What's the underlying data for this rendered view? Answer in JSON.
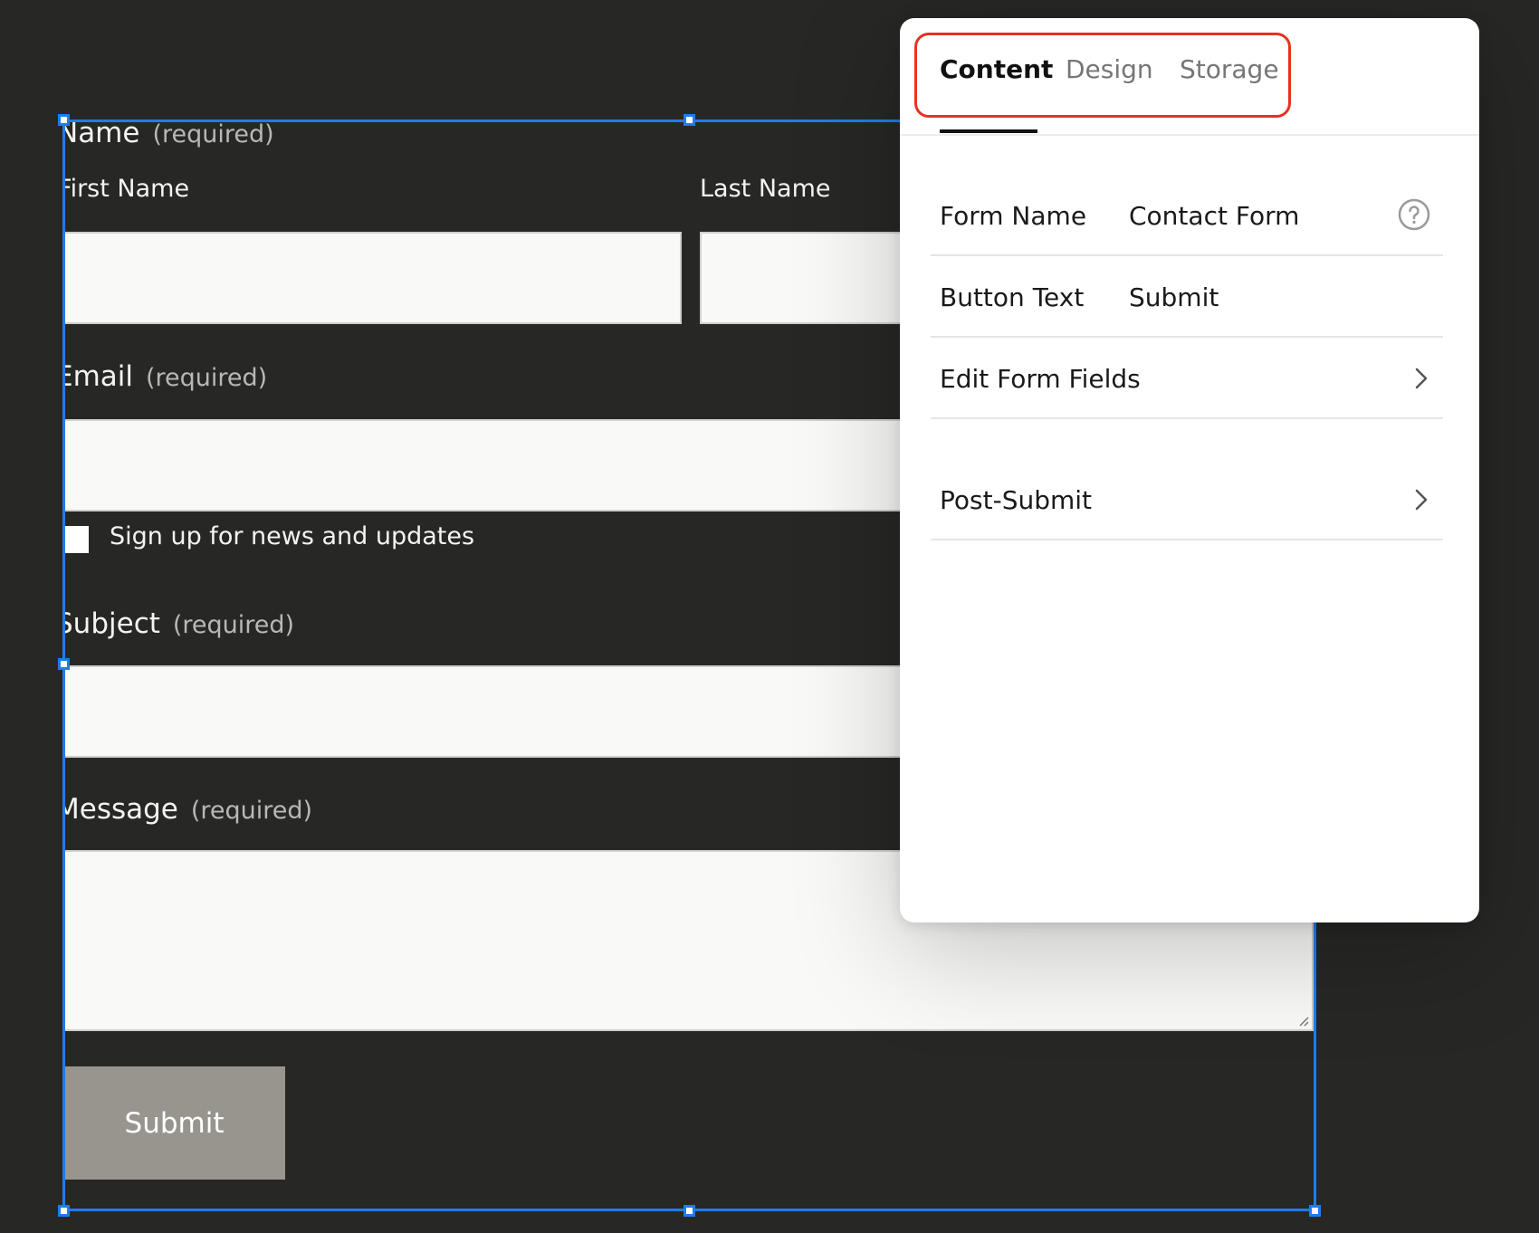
{
  "form": {
    "name_label": "Name",
    "name_required": "(required)",
    "first_name_label": "First Name",
    "last_name_label": "Last Name",
    "email_label": "Email",
    "email_required": "(required)",
    "newsletter_label": "Sign up for news and updates",
    "subject_label": "Subject",
    "subject_required": "(required)",
    "message_label": "Message",
    "message_required": "(required)",
    "submit_label": "Submit"
  },
  "panel": {
    "tabs": [
      {
        "label": "Content",
        "active": true
      },
      {
        "label": "Design",
        "active": false
      },
      {
        "label": "Storage",
        "active": false
      }
    ],
    "rows": {
      "form_name": {
        "label": "Form Name",
        "value": "Contact Form"
      },
      "button_text": {
        "label": "Button Text",
        "value": "Submit"
      },
      "edit_fields": {
        "label": "Edit Form Fields"
      },
      "post_submit": {
        "label": "Post-Submit"
      }
    }
  },
  "colors": {
    "canvas_bg": "#272726",
    "selection": "#1f7cf0",
    "tab_highlight": "#e7321f",
    "submit_button": "#98958f"
  },
  "icons": {
    "help": "question-circle-icon",
    "chevron": "chevron-right-icon"
  }
}
